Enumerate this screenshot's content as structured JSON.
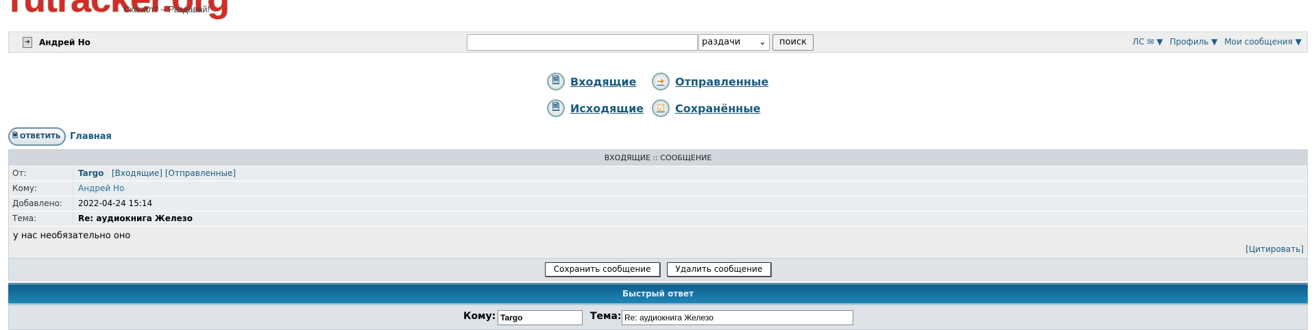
{
  "logo": {
    "text": "rutracker.org",
    "tagline": "Скачал? – Раздавай!"
  },
  "topbar": {
    "username": "Андрей Но",
    "search_value": "",
    "search_scope": "раздачи",
    "search_button": "поиск",
    "links": [
      "ЛС ✉ ▼",
      "Профиль ▼",
      "Мои сообщения ▼"
    ]
  },
  "pm_nav": {
    "inbox": "Входящие",
    "sent": "Отправленные",
    "outbox": "Исходящие",
    "saved": "Сохранённые"
  },
  "actions": {
    "reply_button": "ОТВЕТИТЬ",
    "home_link": "Главная"
  },
  "message": {
    "header": "ВХОДЯЩИЕ :: СООБЩЕНИЕ",
    "from_label": "От:",
    "from": "Targo",
    "from_inbox": "[Входящие]",
    "from_sent": "[Отправленные]",
    "to_label": "Кому:",
    "to": "Андрей Но",
    "date_label": "Добавлено:",
    "date": "2022-04-24 15:14",
    "subject_label": "Тема:",
    "subject": "Re: аудиокнига Железо",
    "body": "у нас необязательно оно",
    "quote": "[Цитировать]",
    "save_button": "Сохранить сообщение",
    "delete_button": "Удалить сообщение"
  },
  "quick_reply": {
    "title": "Быстрый ответ",
    "to_label": "Кому:",
    "to_value": "Targo",
    "subject_label": "Тема:",
    "subject_value": "Re: аудиокнига Железо"
  }
}
